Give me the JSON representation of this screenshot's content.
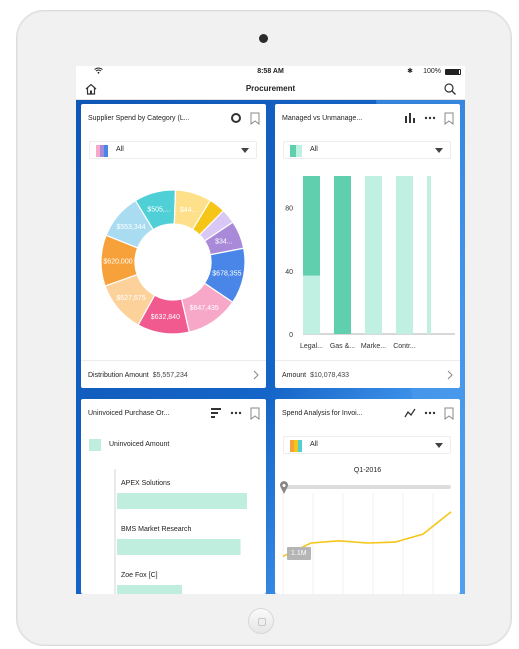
{
  "status": {
    "time": "8:58 AM",
    "battery": "100%"
  },
  "nav": {
    "title": "Procurement"
  },
  "colors": {
    "accent": "#1565c8",
    "teal_dark": "#5fcfae",
    "teal_light": "#bff0e2",
    "bar_teal": "#bfeede"
  },
  "cards": {
    "supplier": {
      "title": "Supplier Spend by Category (L...",
      "filter": "All",
      "footer_label": "Distribution Amount",
      "footer_value": "$5,557,234"
    },
    "managed": {
      "title": "Managed vs Unmanage...",
      "filter": "All",
      "footer_label": "Amount",
      "footer_value": "$10,078,433"
    },
    "uninvoiced": {
      "title": "Uninvoiced Purchase Or...",
      "legend": "Uninvoiced Amount"
    },
    "spend": {
      "title": "Spend Analysis for Invoi...",
      "filter": "All",
      "period": "Q1-2016",
      "tooltip": "1.1M"
    }
  },
  "chart_data": [
    {
      "type": "pie",
      "title": "Supplier Spend by Category (L...",
      "slices": [
        {
          "label": "$505,...",
          "color": "#4fcfd6"
        },
        {
          "label": "$44...",
          "color": "#ffe08a"
        },
        {
          "label": "",
          "color": "#f5c518"
        },
        {
          "label": "",
          "color": "#d9c8f5"
        },
        {
          "label": "$34...",
          "color": "#a98ad8"
        },
        {
          "label": "$678,355",
          "color": "#4a86e8"
        },
        {
          "label": "$647,435",
          "color": "#f7a8c8"
        },
        {
          "label": "$632,840",
          "color": "#f05a8e"
        },
        {
          "label": "$627,675",
          "color": "#fcd29a"
        },
        {
          "label": "$620,000",
          "color": "#f7a13a"
        },
        {
          "label": "$553,344",
          "color": "#a9dcf0"
        }
      ],
      "values": [
        505000,
        440000,
        200000,
        180000,
        340000,
        678355,
        647435,
        632840,
        627675,
        620000,
        553344
      ]
    },
    {
      "type": "bar",
      "title": "Managed vs Unmanage...",
      "categories": [
        "Legal...",
        "Gas &...",
        "Marke...",
        "Contr...",
        ""
      ],
      "yticks": [
        "0",
        "40",
        "80"
      ],
      "ylim": [
        0,
        100
      ],
      "series": [
        {
          "values": [
            100,
            100,
            100,
            100,
            100
          ]
        },
        {
          "values": [
            37,
            0,
            0,
            0,
            0
          ]
        }
      ]
    },
    {
      "type": "bar",
      "title": "Uninvoiced Purchase Or...",
      "categories": [
        "APEX Solutions",
        "BMS Market Research",
        "Zoe Fox [C]"
      ],
      "series": [
        {
          "name": "Uninvoiced Amount",
          "values": [
            100,
            95,
            50
          ]
        }
      ]
    },
    {
      "type": "line",
      "title": "Spend Analysis for Invoi...",
      "x": [
        0,
        1,
        2,
        3,
        4,
        5,
        6
      ],
      "values": [
        1.1,
        1.4,
        1.45,
        1.4,
        1.42,
        1.6,
        2.1
      ],
      "annotations": [
        "1.1M"
      ]
    }
  ]
}
